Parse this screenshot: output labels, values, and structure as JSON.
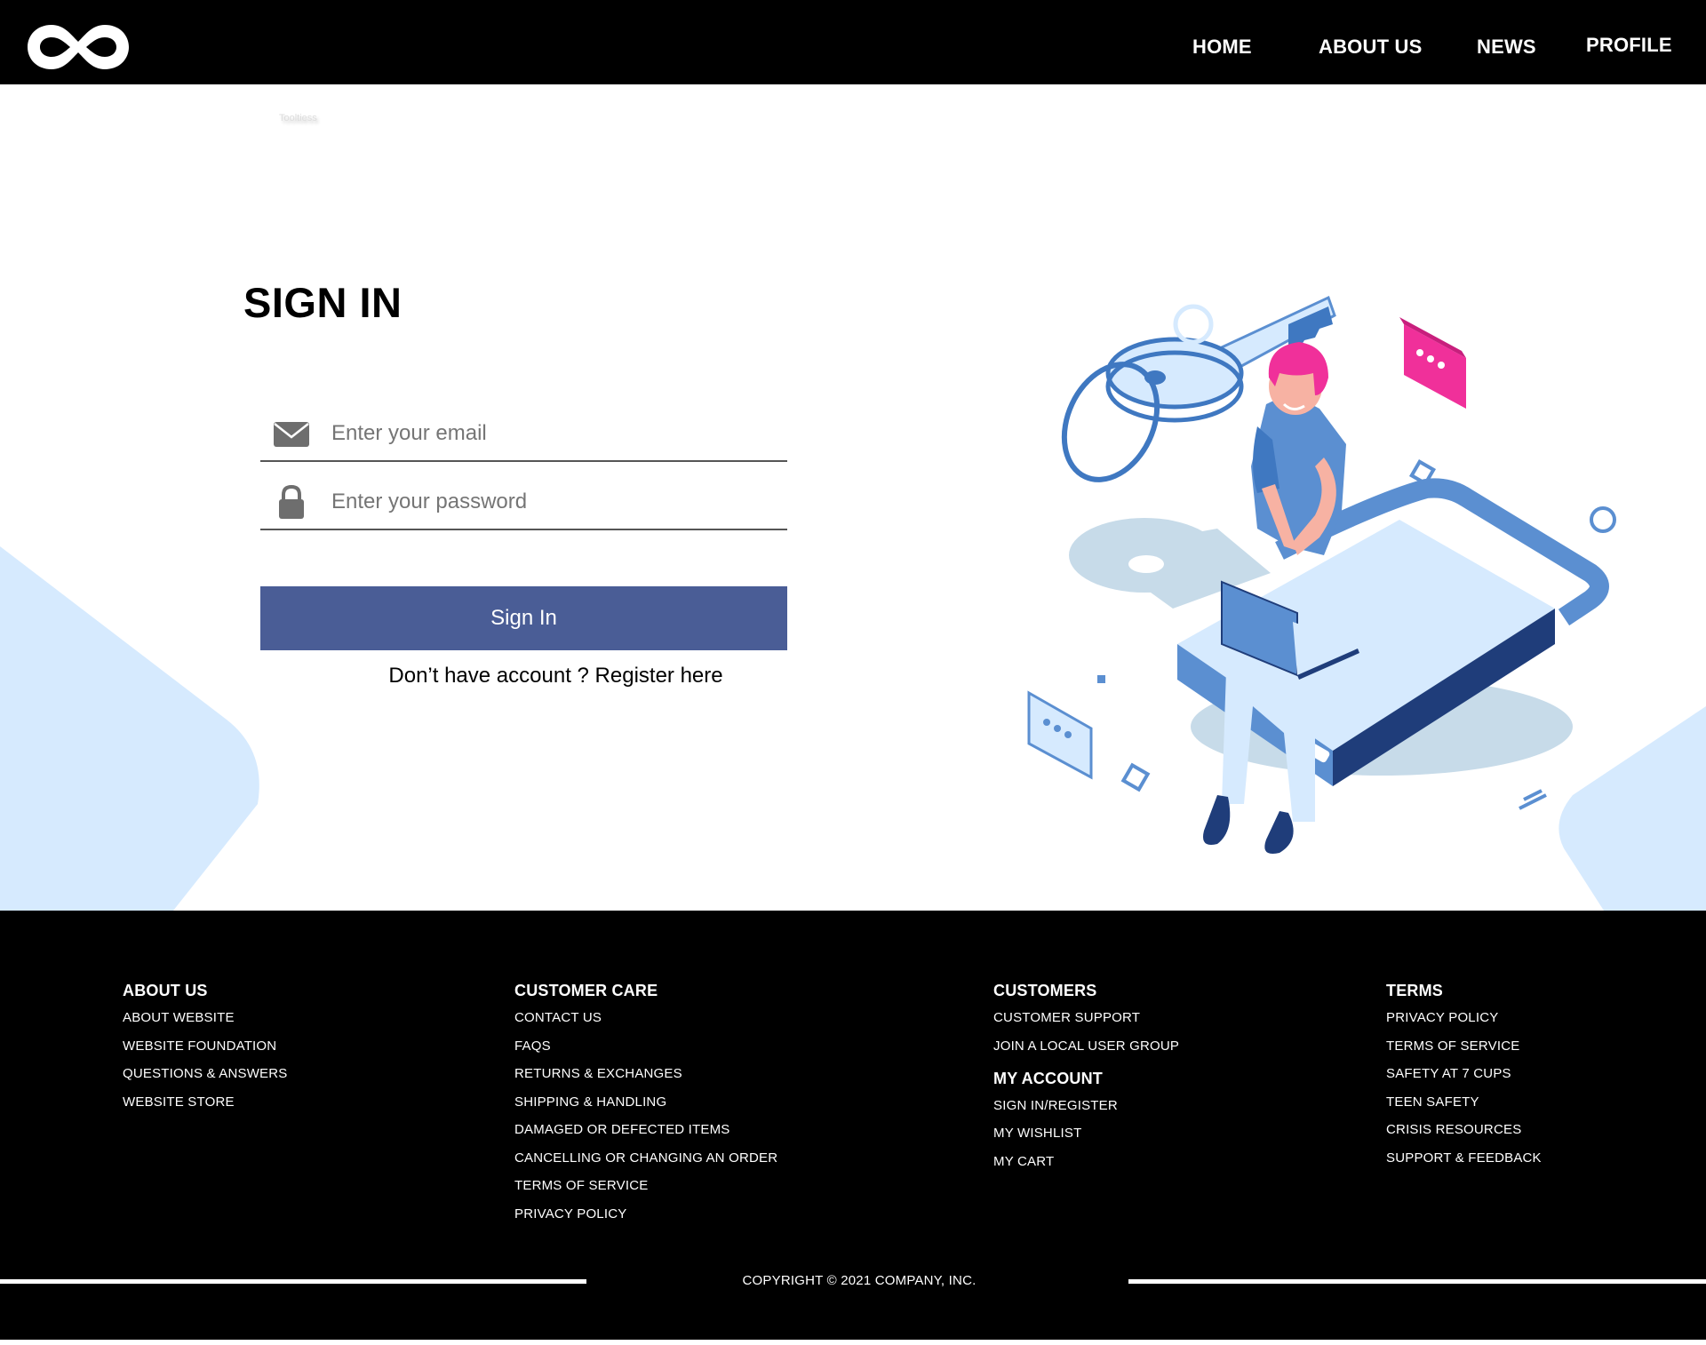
{
  "header": {
    "nav": [
      {
        "label": "HOME"
      },
      {
        "label": "ABOUT US"
      },
      {
        "label": "NEWS"
      },
      {
        "label": "PROFILE"
      }
    ]
  },
  "ghost_text": "Tooltiess",
  "signin": {
    "title": "SIGN IN",
    "email_placeholder": "Enter your email",
    "password_placeholder": "Enter your password",
    "button_label": "Sign In",
    "register_text": "Don’t have account ? Register here"
  },
  "footer": {
    "columns": [
      {
        "heading": "ABOUT US",
        "links": [
          "ABOUT WEBSITE",
          "WEBSITE FOUNDATION",
          "QUESTIONS & ANSWERS",
          "WEBSITE STORE"
        ]
      },
      {
        "heading": "CUSTOMER CARE",
        "links": [
          "CONTACT US",
          "FAQS",
          "RETURNS & EXCHANGES",
          "SHIPPING & HANDLING",
          "DAMAGED OR DEFECTED ITEMS",
          "CANCELLING OR CHANGING AN ORDER",
          "TERMS OF SERVICE",
          "PRIVACY POLICY"
        ]
      },
      {
        "heading": "CUSTOMERS",
        "links": [
          "CUSTOMER SUPPORT",
          "JOIN A LOCAL USER GROUP"
        ],
        "heading2": "MY ACCOUNT",
        "links2": [
          "SIGN IN/REGISTER",
          "MY WISHLIST",
          "MY CART"
        ]
      },
      {
        "heading": "TERMS",
        "links": [
          "PRIVACY POLICY",
          "TERMS OF SERVICE",
          "SAFETY AT 7 CUPS",
          "TEEN SAFETY",
          "CRISIS RESOURCES",
          "SUPPORT & FEEDBACK"
        ]
      }
    ],
    "copyright": "COPYRIGHT © 2021 COMPANY, INC."
  },
  "colors": {
    "header_bg": "#000000",
    "button_bg": "#4a5d96",
    "accent_light_blue": "#d6eafe",
    "illustration_blue": "#5b8fd1",
    "illustration_pink": "#f0309a"
  },
  "icons": [
    "infinity-logo-icon",
    "envelope-icon",
    "lock-icon"
  ]
}
